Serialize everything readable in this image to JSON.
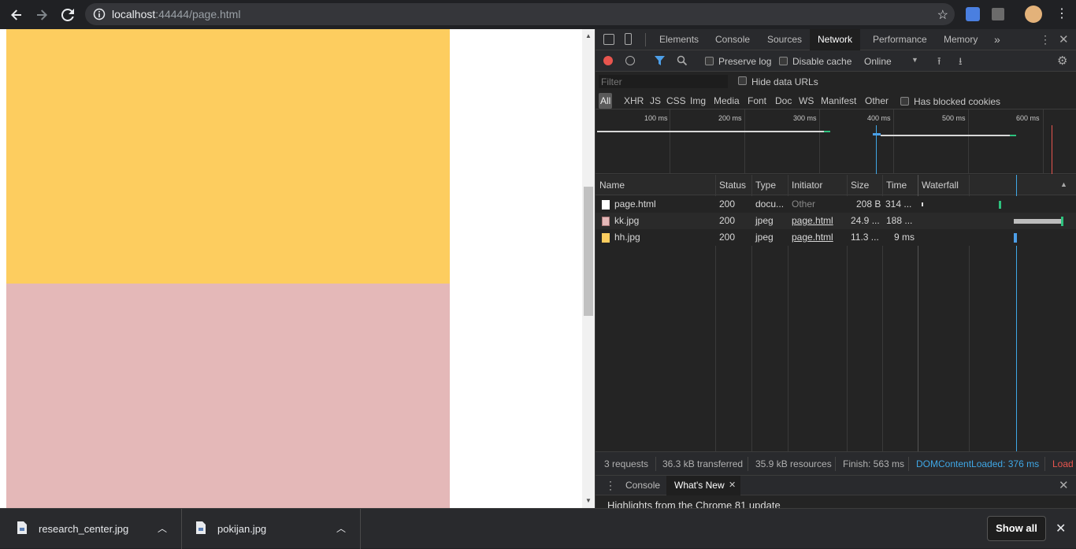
{
  "browser": {
    "url_host": "localhost",
    "url_rest": ":44444/page.html"
  },
  "devtools": {
    "tabs": [
      "Elements",
      "Console",
      "Sources",
      "Network",
      "Performance",
      "Memory"
    ],
    "more_tabs": "»",
    "toolbar": {
      "preserve_log": "Preserve log",
      "disable_cache": "Disable cache",
      "throttling": "Online"
    },
    "filter": {
      "placeholder": "Filter",
      "hide_data_urls": "Hide data URLs",
      "has_blocked_cookies": "Has blocked cookies",
      "types": [
        "All",
        "XHR",
        "JS",
        "CSS",
        "Img",
        "Media",
        "Font",
        "Doc",
        "WS",
        "Manifest",
        "Other"
      ]
    },
    "overview_ticks": [
      "100 ms",
      "200 ms",
      "300 ms",
      "400 ms",
      "500 ms",
      "600 ms"
    ],
    "columns": {
      "name": "Name",
      "status": "Status",
      "type": "Type",
      "initiator": "Initiator",
      "size": "Size",
      "time": "Time",
      "waterfall": "Waterfall"
    },
    "requests": [
      {
        "name": "page.html",
        "status": "200",
        "type": "docu...",
        "initiator": "Other",
        "size": "208 B",
        "time": "314 ...",
        "icon_color": "#ffffff"
      },
      {
        "name": "kk.jpg",
        "status": "200",
        "type": "jpeg",
        "initiator": "page.html",
        "size": "24.9 ...",
        "time": "188 ...",
        "icon_color": "#e4b8b8"
      },
      {
        "name": "hh.jpg",
        "status": "200",
        "type": "jpeg",
        "initiator": "page.html",
        "size": "11.3 ...",
        "time": "9 ms",
        "icon_color": "#fdcd5f"
      }
    ],
    "summary": {
      "requests": "3 requests",
      "transferred": "36.3 kB transferred",
      "resources": "35.9 kB resources",
      "finish": "Finish: 563 ms",
      "dom_content_loaded": "DOMContentLoaded: 376 ms",
      "load": "Load"
    },
    "drawer": {
      "tabs": [
        "Console",
        "What's New"
      ],
      "content": "Highlights from the Chrome 81 update"
    }
  },
  "downloads": {
    "items": [
      "research_center.jpg",
      "pokijan.jpg"
    ],
    "show_all": "Show all"
  },
  "colors": {
    "image_yellow": "#fdcd5f",
    "image_pink": "#e4b8b8",
    "dom_content_loaded": "#3fa7e6",
    "load": "#e8554e"
  }
}
